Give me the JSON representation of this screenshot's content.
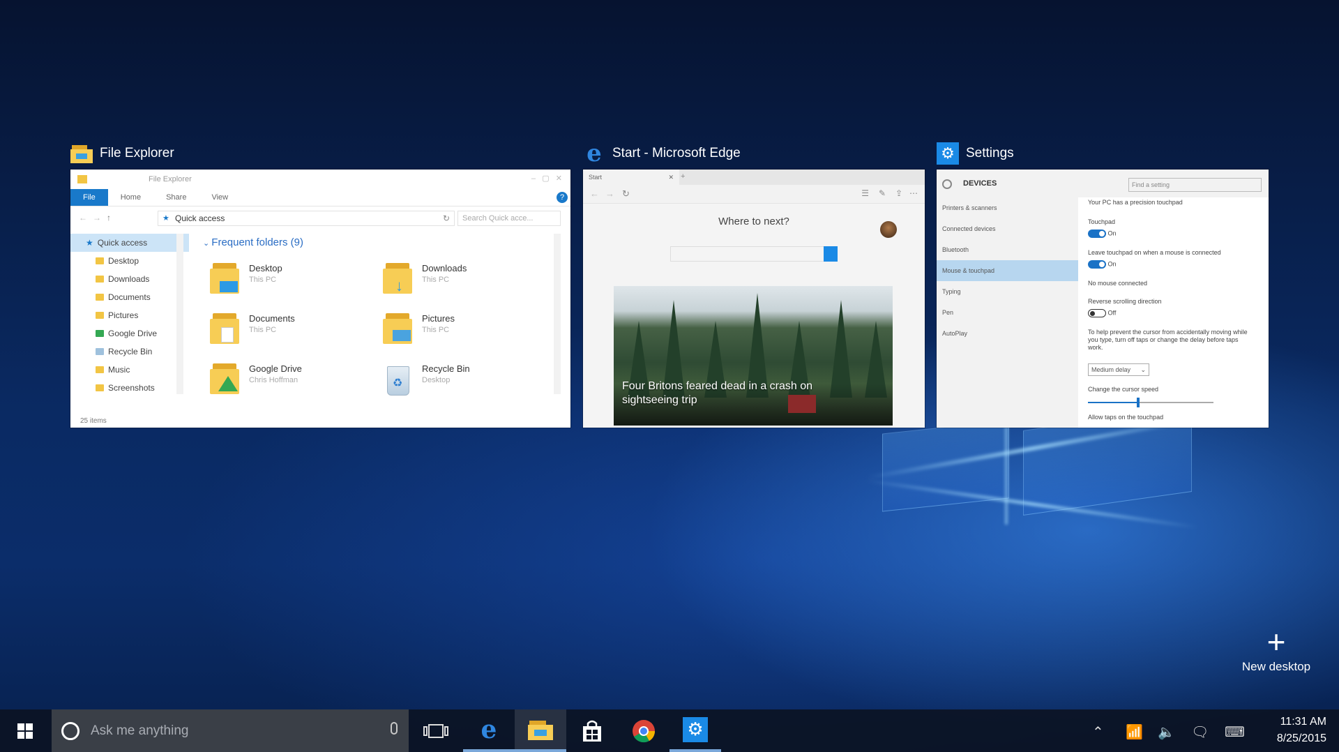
{
  "windows": {
    "file_explorer": {
      "heading": "File Explorer",
      "title_bar": "File Explorer",
      "ribbon_tabs": [
        "File",
        "Home",
        "Share",
        "View"
      ],
      "address": "Quick access",
      "search_placeholder": "Search Quick acce...",
      "nav_items": [
        "Quick access",
        "Desktop",
        "Downloads",
        "Documents",
        "Pictures",
        "Google Drive",
        "Recycle Bin",
        "Music",
        "Screenshots"
      ],
      "section_title": "Frequent folders (9)",
      "folders": [
        {
          "name": "Desktop",
          "sub": "This PC"
        },
        {
          "name": "Downloads",
          "sub": "This PC"
        },
        {
          "name": "Documents",
          "sub": "This PC"
        },
        {
          "name": "Pictures",
          "sub": "This PC"
        },
        {
          "name": "Google Drive",
          "sub": "Chris Hoffman"
        },
        {
          "name": "Recycle Bin",
          "sub": "Desktop"
        }
      ],
      "status": "25 items"
    },
    "edge": {
      "heading": "Start - Microsoft Edge",
      "tab_label": "Start",
      "where_next": "Where to next?",
      "news_caption": "Four Britons feared dead in a crash on sightseeing trip"
    },
    "settings": {
      "heading": "Settings",
      "app_title": "DEVICES",
      "find_placeholder": "Find a setting",
      "side_items": [
        "Printers & scanners",
        "Connected devices",
        "Bluetooth",
        "Mouse & touchpad",
        "Typing",
        "Pen",
        "AutoPlay"
      ],
      "selected_side_item": "Mouse & touchpad",
      "rows": {
        "precision_note": "Your PC has a precision touchpad",
        "touchpad_label": "Touchpad",
        "touchpad_state": "On",
        "leave_on_label": "Leave touchpad on when a mouse is connected",
        "leave_on_state": "On",
        "no_mouse": "No mouse connected",
        "reverse_label": "Reverse scrolling direction",
        "reverse_state": "Off",
        "delay_note": "To help prevent the cursor from accidentally moving while you type, turn off taps or change the delay before taps work.",
        "delay_value": "Medium delay",
        "cursor_speed_label": "Change the cursor speed",
        "cursor_speed_value": 0.4,
        "allow_taps": "Allow taps on the touchpad"
      }
    }
  },
  "new_desktop": {
    "label": "New desktop"
  },
  "taskbar": {
    "search_placeholder": "Ask me anything",
    "pinned": [
      {
        "icon": "edge-icon",
        "running": true
      },
      {
        "icon": "file-explorer-icon",
        "running": true,
        "active": true
      },
      {
        "icon": "store-icon",
        "running": false
      },
      {
        "icon": "chrome-icon",
        "running": false
      },
      {
        "icon": "settings-icon",
        "running": true
      }
    ],
    "clock_time": "11:31 AM",
    "clock_date": "8/25/2015"
  }
}
